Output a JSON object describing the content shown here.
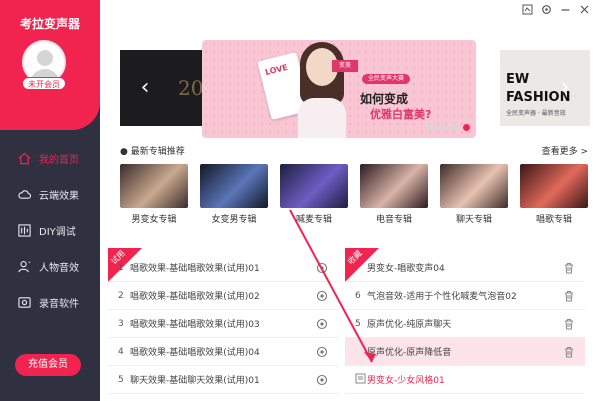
{
  "app": {
    "title": "考拉变声器"
  },
  "sidebar": {
    "vip_badge": "未开会员",
    "items": [
      {
        "label": "我的首页",
        "icon": "home-icon"
      },
      {
        "label": "云端效果",
        "icon": "cloud-icon"
      },
      {
        "label": "DIY调试",
        "icon": "equalizer-icon"
      },
      {
        "label": "人物音效",
        "icon": "user-sound-icon"
      },
      {
        "label": "录音软件",
        "icon": "mic-recorder-icon"
      }
    ],
    "recharge": "充值会员"
  },
  "banner": {
    "left_text": "20",
    "right_line1": "EW",
    "right_line2": "FASHION",
    "right_small": "全民变声器 · 最新音效",
    "love_card": "LOVE",
    "tag": "变美",
    "small_label": "全民变声大赛",
    "headline1": "如何变成",
    "headline2": "优雅白富美?",
    "active_dot": 3
  },
  "albums": {
    "title": "最新专辑推荐",
    "more": "查看更多 >",
    "items": [
      {
        "label": "男变女专辑",
        "c1": "#3a2c2c",
        "c2": "#c9a98f"
      },
      {
        "label": "女变男专辑",
        "c1": "#121826",
        "c2": "#5a76b8"
      },
      {
        "label": "喊麦专辑",
        "c1": "#1c1f3e",
        "c2": "#6e5cc4"
      },
      {
        "label": "电音专辑",
        "c1": "#2b1a1e",
        "c2": "#d9b3a7"
      },
      {
        "label": "聊天专辑",
        "c1": "#3d2b27",
        "c2": "#e8c2b2"
      },
      {
        "label": "唱歌专辑",
        "c1": "#3a1616",
        "c2": "#e06a5a"
      }
    ]
  },
  "trial_panel": {
    "ribbon": "试用",
    "rows": [
      {
        "no": "1",
        "name": "唱歌效果-基础唱歌效果(试用)01"
      },
      {
        "no": "2",
        "name": "唱歌效果-基础唱歌效果(试用)02"
      },
      {
        "no": "3",
        "name": "唱歌效果-基础唱歌效果(试用)03"
      },
      {
        "no": "4",
        "name": "唱歌效果-基础唱歌效果(试用)04"
      },
      {
        "no": "5",
        "name": "聊天效果-基础聊天效果(试用)01"
      }
    ]
  },
  "fav_panel": {
    "ribbon": "收藏",
    "rows": [
      {
        "no": "",
        "name": "男变女-唱歌变声04"
      },
      {
        "no": "6",
        "name": "气泡音效-适用于个性化喊麦气泡音02"
      },
      {
        "no": "5",
        "name": "原声优化-纯原声聊天"
      },
      {
        "no": "",
        "name": "原声优化-原声降低音"
      },
      {
        "no": "",
        "name": "男变女-少女风格01"
      }
    ]
  },
  "colors": {
    "accent": "#f0244f",
    "sidebar": "#2f3040"
  }
}
